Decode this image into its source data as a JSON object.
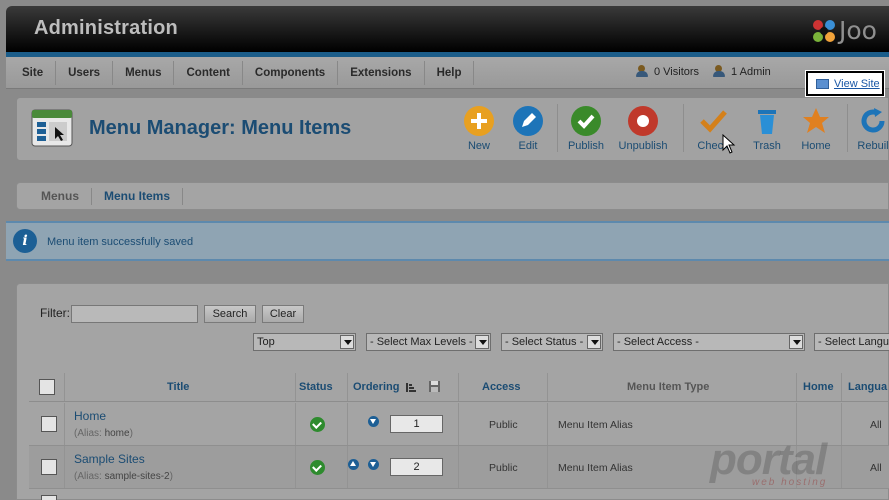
{
  "header": {
    "title": "Administration",
    "logo_text": "Joo"
  },
  "menubar": {
    "items": [
      "Site",
      "Users",
      "Menus",
      "Content",
      "Components",
      "Extensions",
      "Help"
    ],
    "visitors": "0 Visitors",
    "admins": "1 Admin",
    "view_site": "View Site"
  },
  "toolbar": {
    "page_title": "Menu Manager: Menu Items",
    "buttons": {
      "new": "New",
      "edit": "Edit",
      "publish": "Publish",
      "unpublish": "Unpublish",
      "checkin": "Check",
      "trash": "Trash",
      "home": "Home",
      "rebuild": "Rebuil"
    }
  },
  "submenu": {
    "tabs": [
      "Menus",
      "Menu Items"
    ]
  },
  "message": {
    "text": "Menu item successfully saved"
  },
  "filter": {
    "label": "Filter:",
    "value": "",
    "search_label": "Search",
    "clear_label": "Clear",
    "selects": {
      "menu": "Top",
      "max_levels": "- Select Max Levels -",
      "status": "- Select Status -",
      "access": "- Select Access -",
      "language": "- Select Langu"
    }
  },
  "table": {
    "headers": {
      "title": "Title",
      "status": "Status",
      "ordering": "Ordering",
      "access": "Access",
      "type": "Menu Item Type",
      "home": "Home",
      "language": "Langua"
    },
    "rows": [
      {
        "title": "Home",
        "alias_label": "(Alias: ",
        "alias": "home",
        "alias_end": ")",
        "order": "1",
        "access": "Public",
        "type": "Menu Item Alias",
        "language": "All"
      },
      {
        "title": "Sample Sites",
        "alias_label": "(Alias: ",
        "alias": "sample-sites-2",
        "alias_end": ")",
        "order": "2",
        "access": "Public",
        "type": "Menu Item Alias",
        "language": "All"
      }
    ]
  },
  "watermark": {
    "brand": "portal",
    "sub": "web hosting"
  }
}
